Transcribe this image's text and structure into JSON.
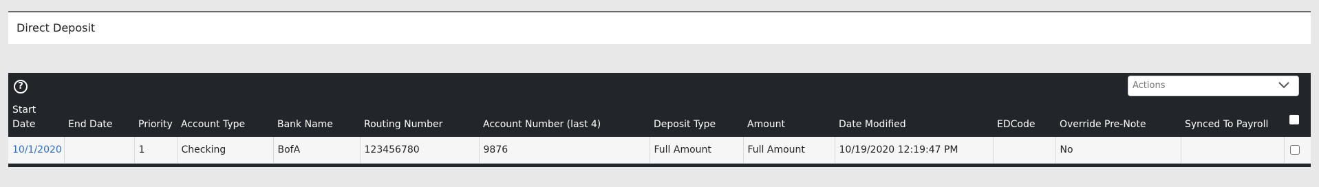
{
  "panel": {
    "title": "Direct Deposit"
  },
  "toolbar": {
    "help_icon": "question-circle-icon",
    "help_glyph": "?",
    "actions_placeholder": "Actions",
    "actions_icon": "chevron-down-icon"
  },
  "table": {
    "columns": [
      "Start Date",
      "End Date",
      "Priority",
      "Account Type",
      "Bank Name",
      "Routing Number",
      "Account Number (last 4)",
      "Deposit Type",
      "Amount",
      "Date Modified",
      "EDCode",
      "Override Pre-Note",
      "Synced To Payroll"
    ],
    "rows": [
      {
        "start_date": "10/1/2020",
        "end_date": "",
        "priority": "1",
        "account_type": "Checking",
        "bank_name": "BofA",
        "routing_number": "123456780",
        "account_number": "9876",
        "deposit_type": "Full Amount",
        "amount": "Full Amount",
        "date_modified": "10/19/2020 12:19:47 PM",
        "edcode": "",
        "override_prenote": "No",
        "synced_to_payroll": "",
        "selected": false
      }
    ]
  },
  "colors": {
    "grid_header_bg": "#222529",
    "link": "#2a6fc9",
    "page_bg": "#e8e8e8"
  }
}
